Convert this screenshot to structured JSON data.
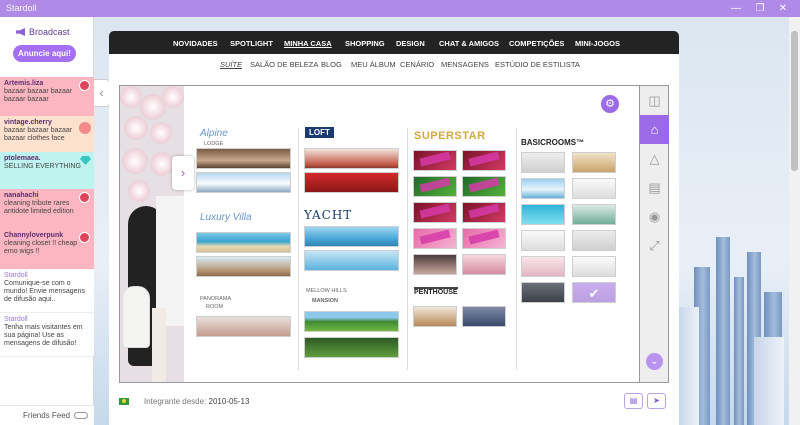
{
  "window": {
    "title": "Stardoll"
  },
  "left_panel": {
    "broadcast_label": "Broadcast",
    "announce_button": "Anuncie aqui!",
    "feed": [
      {
        "user": "Artemis.liza",
        "message": "bazaar bazaar bazaar bazaar bazaar",
        "badge": "notification-badge"
      },
      {
        "user": "vintage.cherry",
        "message": "bazaar bazaar bazaar bazaar clothes face",
        "badge": "crown-badge"
      },
      {
        "user": "ptolemaea.",
        "message": "SELLING EVERYTHING",
        "badge": "gem-badge"
      },
      {
        "user": "nanahachi",
        "message": "cleaning tribute rares antidote limited edition",
        "badge": "notification-badge"
      },
      {
        "user": "Channyloverpunk",
        "message": "cleaning closet !! cheap emo wigs !!",
        "badge": "notification-badge"
      },
      {
        "user": "Stardoll",
        "message": "Comunique-se com o mundo! Envie mensagens de difusão aqui.."
      },
      {
        "user": "Stardoll",
        "message": "Tenha mais visitantes em sua página! Use as mensagens de difusão!"
      }
    ],
    "friends_feed_label": "Friends Feed"
  },
  "nav": {
    "top": [
      "NOVIDADES",
      "SPOTLIGHT",
      "MINHA CASA",
      "SHOPPING",
      "DESIGN",
      "CHAT & AMIGOS",
      "COMPETIÇÕES",
      "MINI-JOGOS"
    ],
    "top_active": "MINHA CASA",
    "sub": [
      "SUÍTE",
      "SALÃO DE BELEZA",
      "BLOG",
      "MEU ÁLBUM",
      "CENÁRIO",
      "MENSAGENS",
      "ESTÚDIO DE ESTILISTA"
    ],
    "sub_active": "SUÍTE"
  },
  "rooms": {
    "alpine": "Alpine",
    "alpine_sub": "LODGE",
    "loft": "LOFT",
    "luxury_villa": "Luxury Villa",
    "yacht": "YACHT",
    "panorama": "PANORAMA",
    "panorama_sub": "ROOM",
    "mansion_top": "MELLOW HILLS",
    "mansion": "MANSION",
    "superstar": "SUPERSTAR",
    "basic_rooms": "BASICROOMS™",
    "penthouse": "PENTHOUSE"
  },
  "footer": {
    "member_since_label": "Integrante desde:",
    "member_since_date": "2010-05-13"
  },
  "icons": {
    "settings": "gear-icon",
    "side": [
      "shopping-bag-icon",
      "home-icon",
      "hanger-icon",
      "sofa-icon",
      "camera-icon",
      "fullscreen-icon"
    ]
  },
  "colors": {
    "accent": "#9b6ae6",
    "titlebar": "#b08ae6",
    "nav": "#232323"
  }
}
